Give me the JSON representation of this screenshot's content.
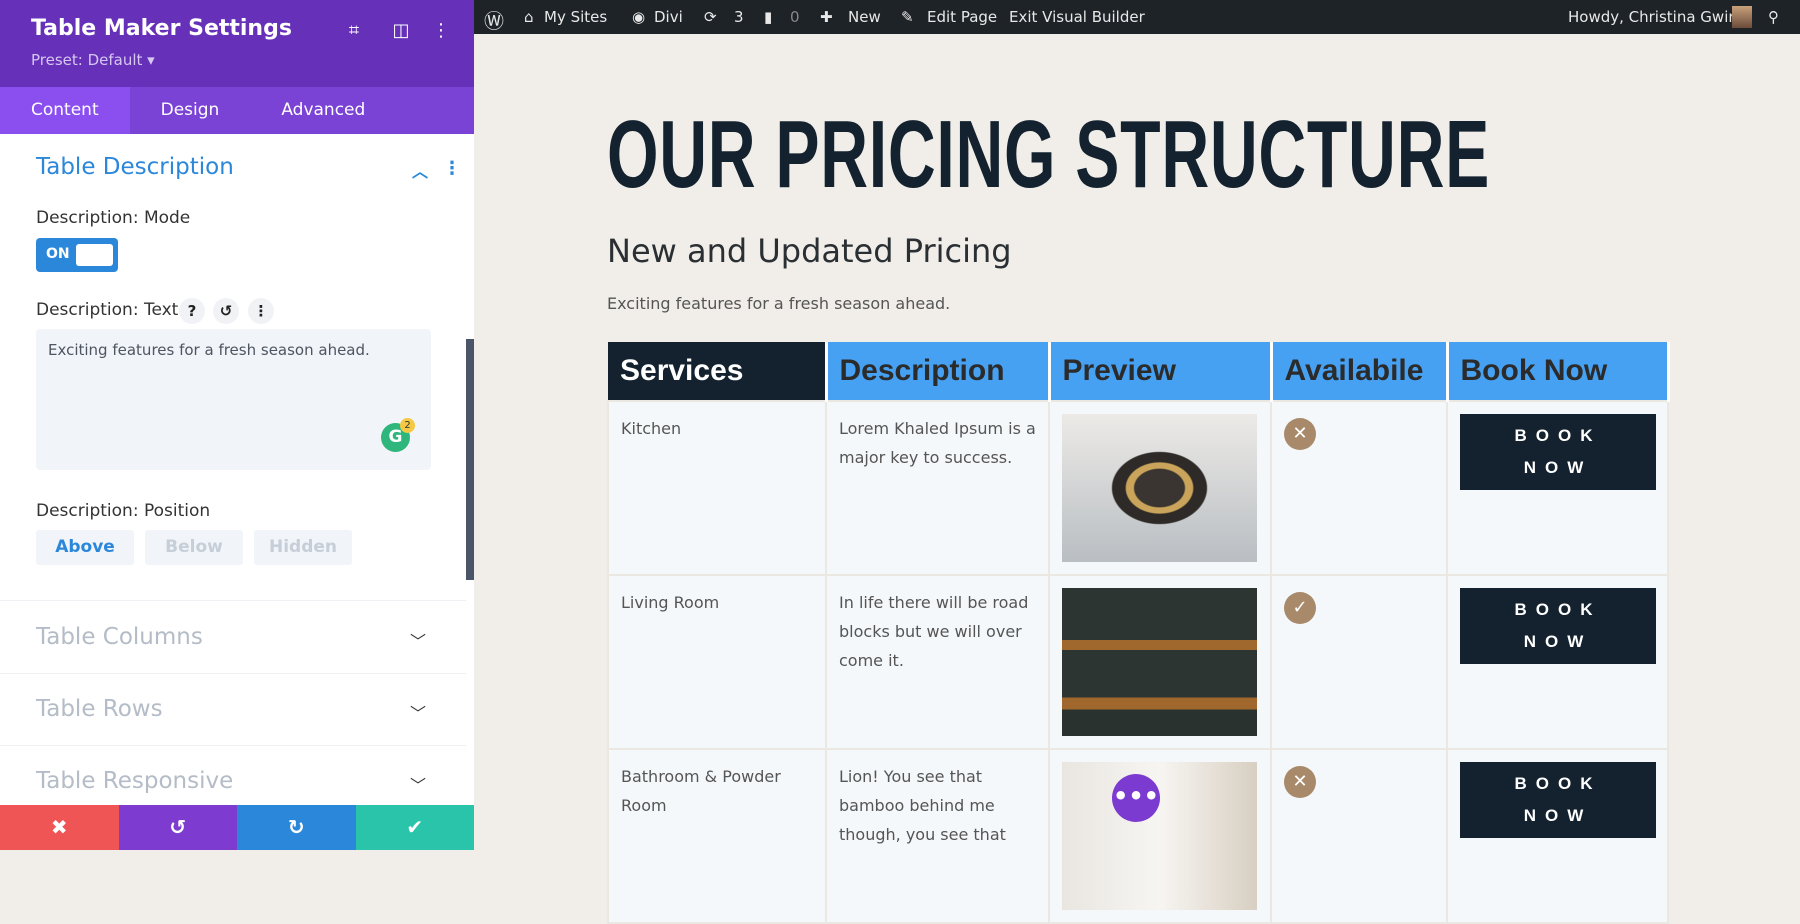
{
  "panel": {
    "title": "Table Maker Settings",
    "preset": "Preset: Default ▾",
    "tabs": [
      "Content",
      "Design",
      "Advanced"
    ],
    "section_open": "Table Description",
    "mode_label": "Description: Mode",
    "toggle": "ON",
    "text_label": "Description: Text",
    "text_value": "Exciting features for a fresh season ahead.",
    "grammarly_count": "2",
    "position_label": "Description: Position",
    "positions": [
      "Above",
      "Below",
      "Hidden"
    ],
    "selected_position": "Above",
    "sections": [
      "Table Columns",
      "Table Rows",
      "Table Responsive"
    ]
  },
  "adminbar": {
    "my_sites": "My Sites",
    "divi": "Divi",
    "updates": "3",
    "comments": "0",
    "new": "New",
    "edit": "Edit Page",
    "exit": "Exit Visual Builder",
    "howdy": "Howdy, Christina Gwira"
  },
  "page": {
    "heading": "OUR PRICING STRUCTURE",
    "subheading": "New and Updated Pricing",
    "description": "Exciting features for a fresh season ahead.",
    "columns": [
      "Services",
      "Description",
      "Preview",
      "Availabile",
      "Book Now"
    ],
    "rows": [
      {
        "service": "Kitchen",
        "description": "Lorem Khaled Ipsum is a major key to success.",
        "available": false,
        "book": "BOOK NOW"
      },
      {
        "service": "Living Room",
        "description": "In life there will be road blocks but we will over come it.",
        "available": true,
        "book": "BOOK NOW"
      },
      {
        "service": "Bathroom & Powder Room",
        "description": "Lion! You see that bamboo behind me though, you see that",
        "available": false,
        "book": "BOOK NOW"
      }
    ]
  },
  "colors": {
    "purple": "#6630b8",
    "blue": "#2b87da",
    "header_blue": "#47a1f2",
    "navy": "#13222e",
    "tan": "#a88a6a"
  }
}
